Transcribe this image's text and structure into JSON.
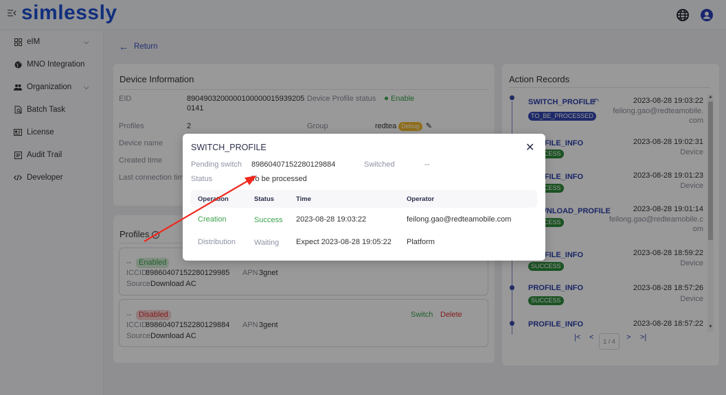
{
  "header": {
    "logo": "simlessly",
    "menu_toggle_icon": "menu-collapse-icon",
    "globe_icon": "globe-icon",
    "user_icon": "user-icon"
  },
  "sidebar": {
    "items": [
      {
        "label": "eIM",
        "icon": "grid-icon",
        "has_chevron": true
      },
      {
        "label": "MNO Integration",
        "icon": "globe-icon"
      },
      {
        "label": "Organization",
        "icon": "users-icon",
        "has_chevron": true
      },
      {
        "label": "Batch Task",
        "icon": "search-doc-icon"
      },
      {
        "label": "License",
        "icon": "id-card-icon"
      },
      {
        "label": "Audit Trail",
        "icon": "list-icon"
      },
      {
        "label": "Developer",
        "icon": "code-icon"
      }
    ]
  },
  "main": {
    "return_label": "Return",
    "device_info": {
      "title": "Device Information",
      "eid_label": "EID",
      "eid_line1": "8904903200000100000015939205",
      "eid_line2": "0141",
      "profile_status_label": "Device Profile status",
      "profile_status_value": "Enable",
      "profiles_label": "Profiles",
      "profiles_value": "2",
      "group_label": "Group",
      "group_value": "redtea",
      "group_badge": "Debug",
      "device_name_label": "Device name",
      "created_time_label": "Created time",
      "last_connection_label": "Last connection time"
    },
    "profiles": {
      "title": "Profiles",
      "items": [
        {
          "name": "--",
          "status": "Enabled",
          "iccid_label": "ICCID",
          "iccid": "89860407152280129985",
          "apn_label": "APN",
          "apn": "3gnet",
          "source_label": "Source",
          "source": "Download AC"
        },
        {
          "name": "--",
          "status": "Disabled",
          "iccid_label": "ICCID",
          "iccid": "89860407152280129884",
          "apn_label": "APN",
          "apn": "3gent",
          "source_label": "Source",
          "source": "Download AC",
          "switch_label": "Switch",
          "delete_label": "Delete"
        }
      ]
    },
    "action_records": {
      "title": "Action Records",
      "items": [
        {
          "name": "SWITCH_PROFILE",
          "badge": "TO_BE_PROCESSED",
          "time": "2023-08-28 19:03:22",
          "operator_line1": "feilong.gao@redteamobile.",
          "operator_line2": "com"
        },
        {
          "name": "PROFILE_INFO",
          "badge": "SUCCESS",
          "time": "2023-08-28 19:02:31",
          "operator_line1": "Device"
        },
        {
          "name": "PROFILE_INFO",
          "badge": "SUCCESS",
          "time": "2023-08-28 19:01:23",
          "operator_line1": "Device"
        },
        {
          "name": "DOWNLOAD_PROFILE",
          "badge": "SUCCESS",
          "time": "2023-08-28 19:01:14",
          "operator_line1": "feilong.gao@redteamobile.c",
          "operator_line2": "om"
        },
        {
          "name": "PROFILE_INFO",
          "badge": "SUCCESS",
          "time": "2023-08-28 18:59:22",
          "operator_line1": "Device"
        },
        {
          "name": "PROFILE_INFO",
          "badge": "SUCCESS",
          "time": "2023-08-28 18:57:26",
          "operator_line1": "Device"
        },
        {
          "name": "PROFILE_INFO",
          "time": "2023-08-28 18:57:22"
        }
      ],
      "pagination": {
        "first": "|<",
        "prev": "<",
        "current": "1 / 4",
        "next": ">",
        "last": ">|"
      }
    }
  },
  "modal": {
    "title": "SWITCH_PROFILE",
    "pending_switch_label": "Pending switch",
    "pending_switch_value": "89860407152280129884",
    "switched_label": "Switched",
    "switched_value": "--",
    "status_label": "Status",
    "status_value": "To be processed",
    "table": {
      "headers": [
        "Operation",
        "Status",
        "Time",
        "Operator"
      ],
      "rows": [
        [
          "Creation",
          "Success",
          "2023-08-28 19:03:22",
          "feilong.gao@redteamobile.com"
        ],
        [
          "Distribution",
          "Waiting",
          "Expect 2023-08-28 19:05:22",
          "Platform"
        ]
      ]
    }
  },
  "colors": {
    "brand": "#1e4fd0",
    "accent": "#3346b0",
    "success": "#3aa14b",
    "danger": "#dd3333",
    "debug": "#f1b72a",
    "annotation_arrow": "#f0281e"
  }
}
